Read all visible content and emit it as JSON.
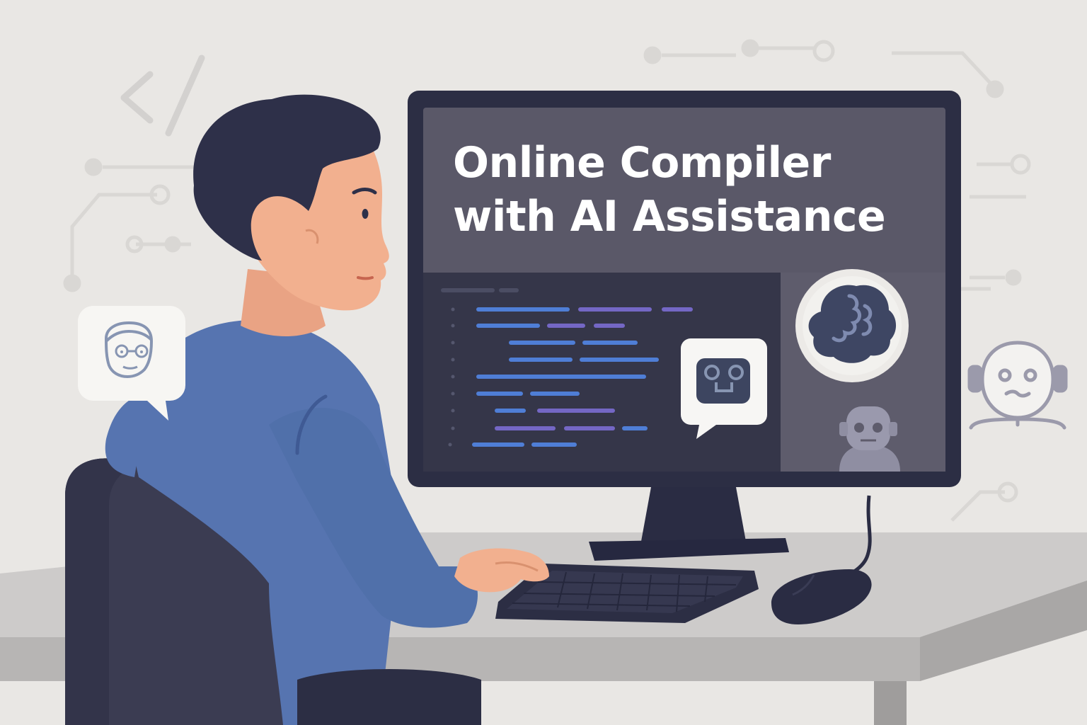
{
  "screen": {
    "headline": "Online Compiler with AI Assistance",
    "code_line_count": 9
  },
  "icons": {
    "left_bubble": "person-with-glasses-icon",
    "screen_chat": "robot-face-chat-icon",
    "screen_brain": "ai-brain-icon",
    "screen_robot": "robot-avatar-icon",
    "right_robot": "robot-with-headphones-icon",
    "code_tag": "code-tag-icon",
    "circuits": "circuit-line-icon"
  },
  "colors": {
    "background": "#e9e7e4",
    "monitor": "#2c2e44",
    "screen": "#5a5868",
    "shirt": "#5674b0",
    "hair": "#2e3049",
    "skin": "#f2b08f",
    "desk": "#cfcdcc",
    "code_blue": "#4f7ed6",
    "code_purple": "#7467c5"
  }
}
